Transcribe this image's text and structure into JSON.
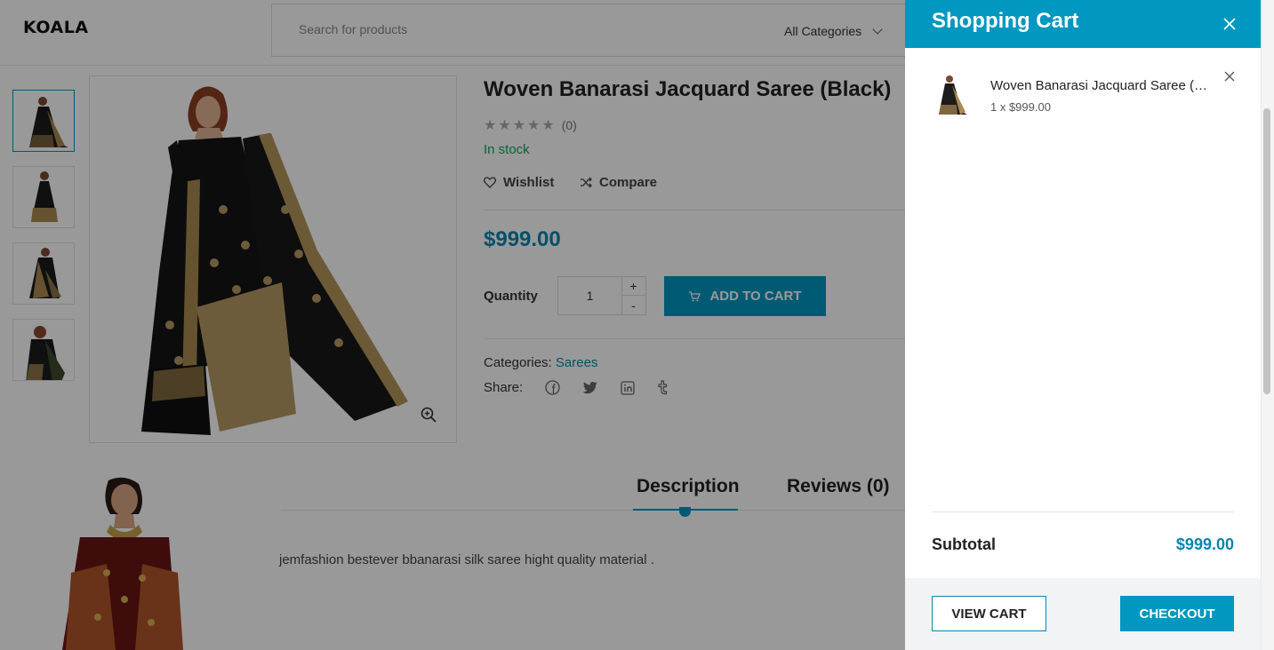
{
  "header": {
    "logo": "KOALA",
    "search_placeholder": "Search for products",
    "category_selected": "All Categories"
  },
  "product": {
    "title": "Woven Banarasi Jacquard Saree (Black)",
    "rating_stars": 0,
    "review_count": "(0)",
    "stock_status": "In stock",
    "wishlist_label": "Wishlist",
    "compare_label": "Compare",
    "price": "$999.00",
    "quantity_label": "Quantity",
    "quantity_value": "1",
    "qty_plus": "+",
    "qty_minus": "-",
    "add_to_cart_label": "ADD TO CART",
    "categories_label": "Categories:",
    "category_link": "Sarees",
    "share_label": "Share:",
    "share_icons": [
      "facebook-icon",
      "twitter-icon",
      "linkedin-icon",
      "tumblr-icon"
    ]
  },
  "tabs": [
    {
      "label": "Description",
      "active": true
    },
    {
      "label": "Reviews (0)",
      "active": false
    }
  ],
  "description_text": "jemfashion bestever bbanarasi silk saree hight quality material .",
  "cart": {
    "title": "Shopping Cart",
    "items": [
      {
        "name": "Woven Banarasi Jacquard Saree (Black)",
        "meta": "1 x $999.00"
      }
    ],
    "subtotal_label": "Subtotal",
    "subtotal_value": "$999.00",
    "view_cart_label": "VIEW CART",
    "checkout_label": "CHECKOUT"
  },
  "colors": {
    "accent": "#0097c0",
    "price": "#0a86ad",
    "in_stock": "#14a35a"
  }
}
